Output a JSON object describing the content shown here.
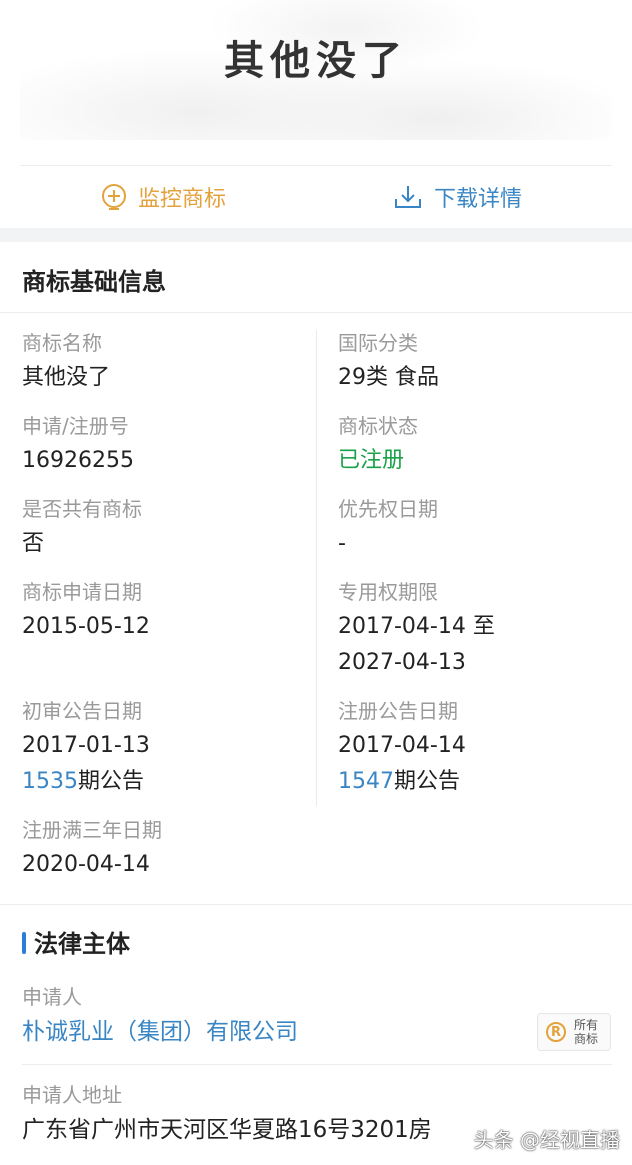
{
  "trademark_image": {
    "text": "其他没了"
  },
  "actions": {
    "monitor_label": "监控商标",
    "download_label": "下载详情"
  },
  "basic_info": {
    "title": "商标基础信息",
    "name_label": "商标名称",
    "name_value": "其他没了",
    "class_label": "国际分类",
    "class_value": "29类 食品",
    "reg_no_label": "申请/注册号",
    "reg_no_value": "16926255",
    "status_label": "商标状态",
    "status_value": "已注册",
    "shared_label": "是否共有商标",
    "shared_value": "否",
    "priority_label": "优先权日期",
    "priority_value": "-",
    "apply_date_label": "商标申请日期",
    "apply_date_value": "2015-05-12",
    "exclusive_label": "专用权期限",
    "exclusive_from": "2017-04-14 至",
    "exclusive_to": "2027-04-13",
    "prelim_label": "初审公告日期",
    "prelim_date": "2017-01-13",
    "prelim_issue": "1535",
    "prelim_issue_suffix": "期公告",
    "reg_pub_label": "注册公告日期",
    "reg_pub_date": "2017-04-14",
    "reg_pub_issue": "1547",
    "reg_pub_issue_suffix": "期公告",
    "three_year_label": "注册满三年日期",
    "three_year_value": "2020-04-14"
  },
  "legal": {
    "title": "法律主体",
    "applicant_label": "申请人",
    "applicant_value": "朴诚乳业（集团）有限公司",
    "badge_r": "R",
    "badge_text": "所有商标",
    "address_label": "申请人地址",
    "address_value": "广东省广州市天河区华夏路16号3201房"
  },
  "watermark": "头条 @经视直播",
  "colors": {
    "accent_orange": "#e3a23b",
    "accent_blue": "#3a86c5",
    "status_green": "#1aa14a",
    "label_gray": "#9a9a9a"
  }
}
